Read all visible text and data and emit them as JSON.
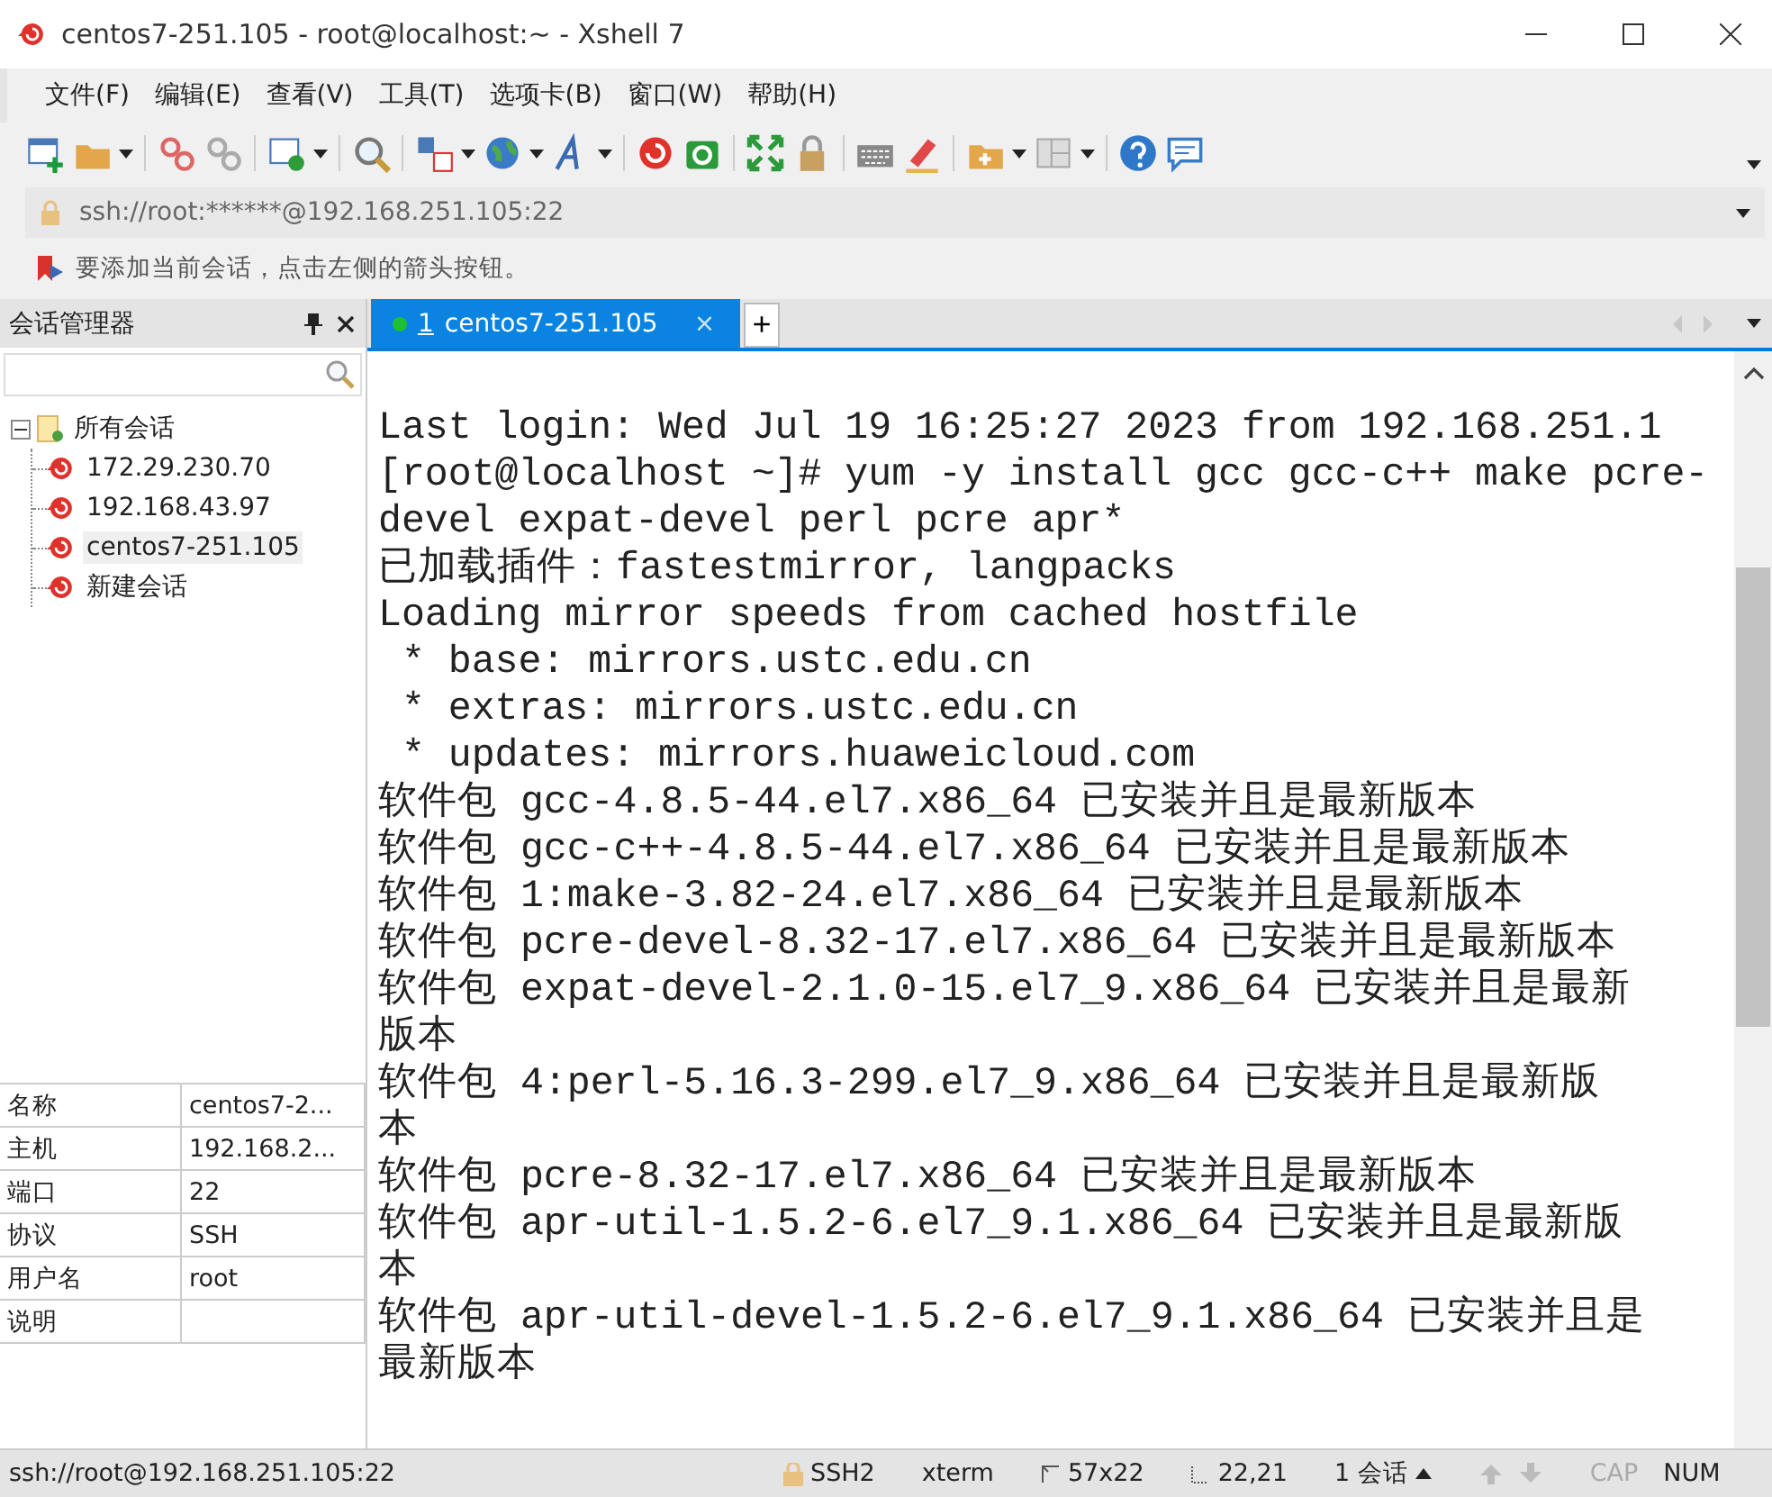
{
  "window": {
    "title": "centos7-251.105 - root@localhost:~ - Xshell 7"
  },
  "menu": [
    "文件(F)",
    "编辑(E)",
    "查看(V)",
    "工具(T)",
    "选项卡(B)",
    "窗口(W)",
    "帮助(H)"
  ],
  "address_bar": {
    "value": "ssh://root:******@192.168.251.105:22"
  },
  "hint_bar": {
    "text": "要添加当前会话，点击左侧的箭头按钮。"
  },
  "session_manager": {
    "title": "会话管理器",
    "tree": [
      {
        "label": "所有会话",
        "expanded": true,
        "children": [
          {
            "label": "172.29.230.70",
            "selected": false
          },
          {
            "label": "192.168.43.97",
            "selected": false
          },
          {
            "label": "centos7-251.105",
            "selected": true
          },
          {
            "label": "新建会话",
            "selected": false
          }
        ]
      }
    ],
    "properties": [
      {
        "name": "名称",
        "value": "centos7-2..."
      },
      {
        "name": "主机",
        "value": "192.168.2..."
      },
      {
        "name": "端口",
        "value": "22"
      },
      {
        "name": "协议",
        "value": "SSH"
      },
      {
        "name": "用户名",
        "value": "root"
      },
      {
        "name": "说明"
      }
    ]
  },
  "tabs": [
    {
      "number": "1",
      "label": "centos7-251.105",
      "selected": true,
      "connected": true,
      "close": "×"
    }
  ],
  "new_tab": "+",
  "terminal": {
    "lines": [
      "Last login: Wed Jul 19 16:25:27 2023 from 192.168.251.1",
      "[root@localhost ~]# yum -y install gcc gcc-c++ make pcre-",
      "devel expat-devel perl pcre apr*",
      "已加载插件：fastestmirror, langpacks",
      "Loading mirror speeds from cached hostfile",
      " * base: mirrors.ustc.edu.cn",
      " * extras: mirrors.ustc.edu.cn",
      " * updates: mirrors.huaweicloud.com",
      "软件包 gcc-4.8.5-44.el7.x86_64 已安装并且是最新版本",
      "软件包 gcc-c++-4.8.5-44.el7.x86_64 已安装并且是最新版本",
      "软件包 1:make-3.82-24.el7.x86_64 已安装并且是最新版本",
      "软件包 pcre-devel-8.32-17.el7.x86_64 已安装并且是最新版本",
      "软件包 expat-devel-2.1.0-15.el7_9.x86_64 已安装并且是最新",
      "版本",
      "软件包 4:perl-5.16.3-299.el7_9.x86_64 已安装并且是最新版",
      "本",
      "软件包 pcre-8.32-17.el7.x86_64 已安装并且是最新版本",
      "软件包 apr-util-1.5.2-6.el7_9.1.x86_64 已安装并且是最新版",
      "本",
      "软件包 apr-util-devel-1.5.2-6.el7_9.1.x86_64 已安装并且是",
      "最新版本"
    ]
  },
  "status_bar": {
    "address": "ssh://root@192.168.251.105:22",
    "protocol": "SSH2",
    "terminal_type": "xterm",
    "size": "57x22",
    "cursor": "22,21",
    "sessions": "1 会话",
    "indicators": [
      {
        "label": "CAP",
        "on": false
      },
      {
        "label": "NUM",
        "on": true
      }
    ]
  }
}
